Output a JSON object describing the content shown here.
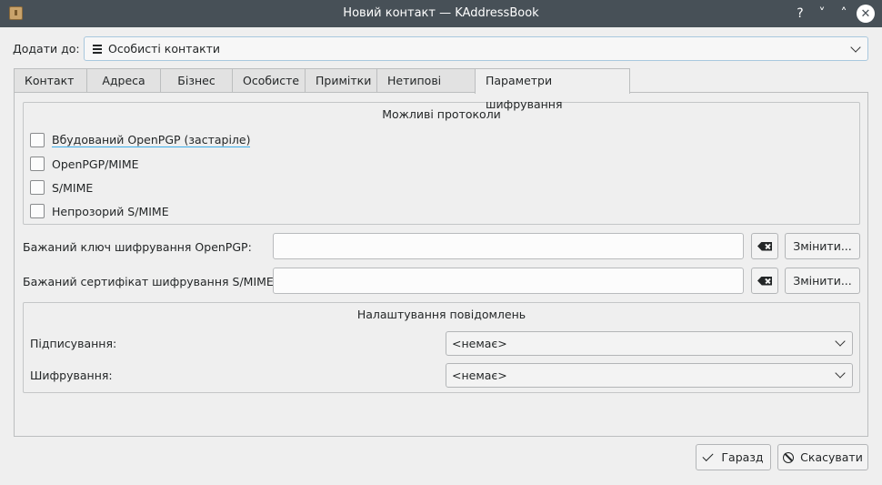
{
  "window": {
    "title": "Новий контакт — KAddressBook",
    "buttons": [
      "?",
      "˅",
      "˄",
      "✕"
    ]
  },
  "add_to": {
    "label": "Додати до:",
    "value": "Особисті контакти"
  },
  "tabs": [
    {
      "label": "Контакт"
    },
    {
      "label": "Адреса"
    },
    {
      "label": "Бізнес"
    },
    {
      "label": "Особисте"
    },
    {
      "label": "Примітки"
    },
    {
      "label": "Нетипові поля"
    },
    {
      "label": "Параметри шифрування",
      "active": true
    }
  ],
  "protocols": {
    "title": "Можливі протоколи",
    "items": [
      {
        "label": "Вбудований OpenPGP (застаріле)",
        "checked": false
      },
      {
        "label": "OpenPGP/MIME",
        "checked": false
      },
      {
        "label": "S/MIME",
        "checked": false
      },
      {
        "label": "Непрозорий S/MIME",
        "checked": false
      }
    ]
  },
  "openpgp_key": {
    "label": "Бажаний ключ шифрування OpenPGP:",
    "value": "",
    "change_label": "Змінити..."
  },
  "smime_cert": {
    "label": "Бажаний сертифікат шифрування S/MIME:",
    "value": "",
    "change_label": "Змінити..."
  },
  "message_settings": {
    "title": "Налаштування повідомлень",
    "signing": {
      "label": "Підписування:",
      "value": "<немає>"
    },
    "encryption": {
      "label": "Шифрування:",
      "value": "<немає>"
    }
  },
  "footer": {
    "ok_label": "Гаразд",
    "cancel_label": "Скасувати"
  }
}
